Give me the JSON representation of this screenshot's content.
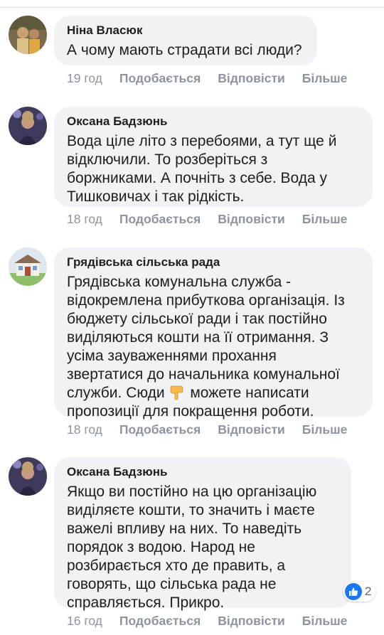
{
  "comments": [
    {
      "author": "Ніна Власюк",
      "text": "А чому мають страдати всі люди?",
      "time": "19 год",
      "like": "Подобається",
      "reply": "Відповісти",
      "more": "Більше"
    },
    {
      "author": "Оксана Бадзюнь",
      "text": "Вода ціле літо з перебоями, а тут ще й\nвідключили. То розберіться з\nборжниками. А почніть з себе. Вода у\nТишковичах і так рідкість.",
      "time": "18 год",
      "like": "Подобається",
      "reply": "Відповісти",
      "more": "Більше"
    },
    {
      "author": "Грядівська сільська рада",
      "text_lines": [
        "Грядівська комунальна служба -",
        "відокремлена прибуткова організація. Із",
        "бюджету сільської ради і так постійно",
        "виділяються кошти на її отримання. З",
        "усіма зауваженнями прохання",
        "звертатися до начальника комунальної"
      ],
      "text_before_emoji": "служби. Сюди",
      "text_after_emoji": "можете написати",
      "text_last": "пропозиції для покращення роботи.",
      "emoji": "pointing-down-hand-emoji",
      "time": "18 год",
      "like": "Подобається",
      "reply": "Відповісти",
      "more": "Більше"
    },
    {
      "author": "Оксана Бадзюнь",
      "text": "Якщо ви постійно на цю організацію\nвиділяєте кошти, то значить і маєте\nважелі впливу на них. То наведіть\nпорядок з водою.  Народ не\nрозбирається хто де править, а\nговорять, що сільська рада не\nсправляється. Прикро.",
      "time": "16 год",
      "like": "Подобається",
      "reply": "Відповісти",
      "more": "Більше",
      "reaction_icon": "thumbs-up-icon",
      "reaction_count": "2"
    }
  ],
  "colors": {
    "bubble": "#f0f2f5",
    "meta": "#8d949e",
    "like_blue": "#1877f2"
  }
}
